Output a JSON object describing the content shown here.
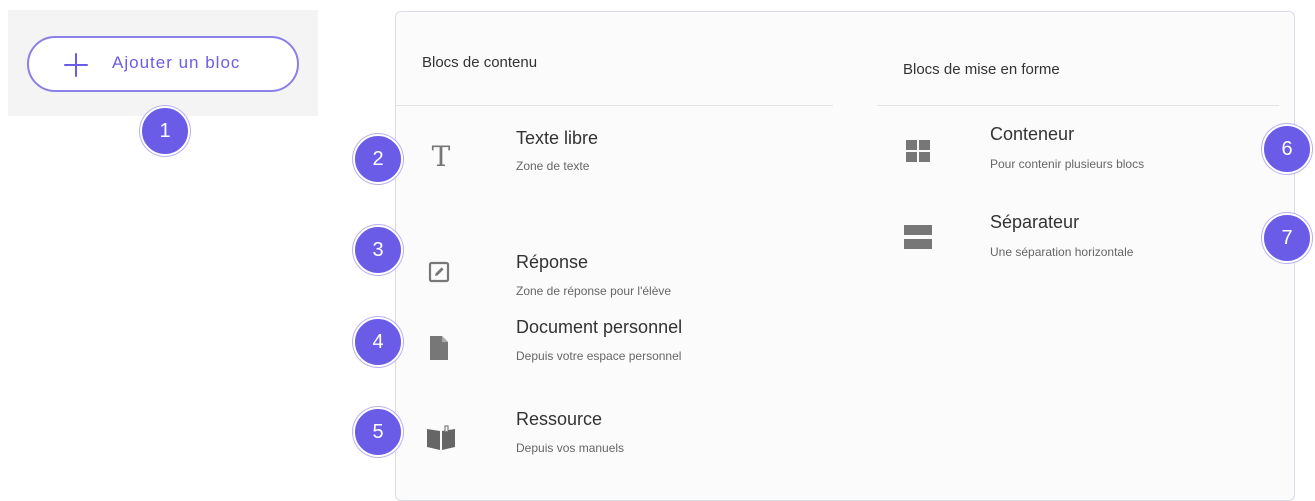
{
  "add_block": {
    "label": "Ajouter un bloc"
  },
  "badges": [
    "1",
    "2",
    "3",
    "4",
    "5",
    "6",
    "7"
  ],
  "columns": {
    "content": {
      "title": "Blocs de contenu",
      "items": [
        {
          "title": "Texte libre",
          "desc": "Zone de texte",
          "icon": "text-icon"
        },
        {
          "title": "Réponse",
          "desc": "Zone de réponse pour l'élève",
          "icon": "edit-icon"
        },
        {
          "title": "Document personnel",
          "desc": "Depuis votre espace personnel",
          "icon": "document-icon"
        },
        {
          "title": "Ressource",
          "desc": "Depuis vos manuels",
          "icon": "book-icon"
        }
      ]
    },
    "layout": {
      "title": "Blocs de mise en forme",
      "items": [
        {
          "title": "Conteneur",
          "desc": "Pour contenir plusieurs blocs",
          "icon": "grid-icon"
        },
        {
          "title": "Séparateur",
          "desc": "Une séparation horizontale",
          "icon": "separator-icon"
        }
      ]
    }
  },
  "colors": {
    "accent": "#6b5ce7",
    "icon_gray": "#777777",
    "text": "#333333",
    "muted": "#666666"
  }
}
